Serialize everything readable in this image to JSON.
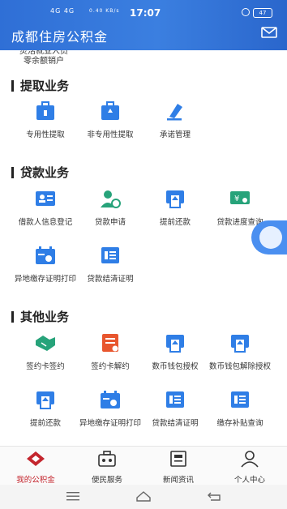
{
  "status_bar": {
    "signal": "4G 4G",
    "speed": "0.40 KB/s",
    "time": "17:07",
    "battery": "47"
  },
  "header": {
    "title": "成都住房公积金"
  },
  "partial_item": {
    "line1": "灵活就业人员",
    "line2": "零余额销户"
  },
  "sections": [
    {
      "title": "提取业务"
    },
    {
      "title": "贷款业务"
    },
    {
      "title": "其他业务"
    }
  ],
  "items": [
    {
      "label": "专用性提取"
    },
    {
      "label": "非专用性提取"
    },
    {
      "label": "承诺管理"
    },
    {
      "label": "借款人信息登记"
    },
    {
      "label": "贷款申请"
    },
    {
      "label": "提前还款"
    },
    {
      "label": "贷款进度查询"
    },
    {
      "label": "异地缴存证明打印"
    },
    {
      "label": "贷款结清证明"
    },
    {
      "label": "签约卡签约"
    },
    {
      "label": "签约卡解约"
    },
    {
      "label": "数币钱包授权"
    },
    {
      "label": "数币钱包解除授权"
    },
    {
      "label": "提前还款"
    },
    {
      "label": "异地缴存证明打印"
    },
    {
      "label": "贷款结清证明"
    },
    {
      "label": "缴存补贴查询"
    }
  ],
  "tabs": [
    {
      "label": "我的公积金",
      "active": true
    },
    {
      "label": "便民服务"
    },
    {
      "label": "新闻资讯"
    },
    {
      "label": "个人中心"
    }
  ],
  "colors": {
    "primary": "#3b7fe0",
    "icon_blue": "#2f7ee6",
    "icon_green": "#27a37a",
    "icon_orange": "#e8562e",
    "active_tab": "#c4262e"
  }
}
